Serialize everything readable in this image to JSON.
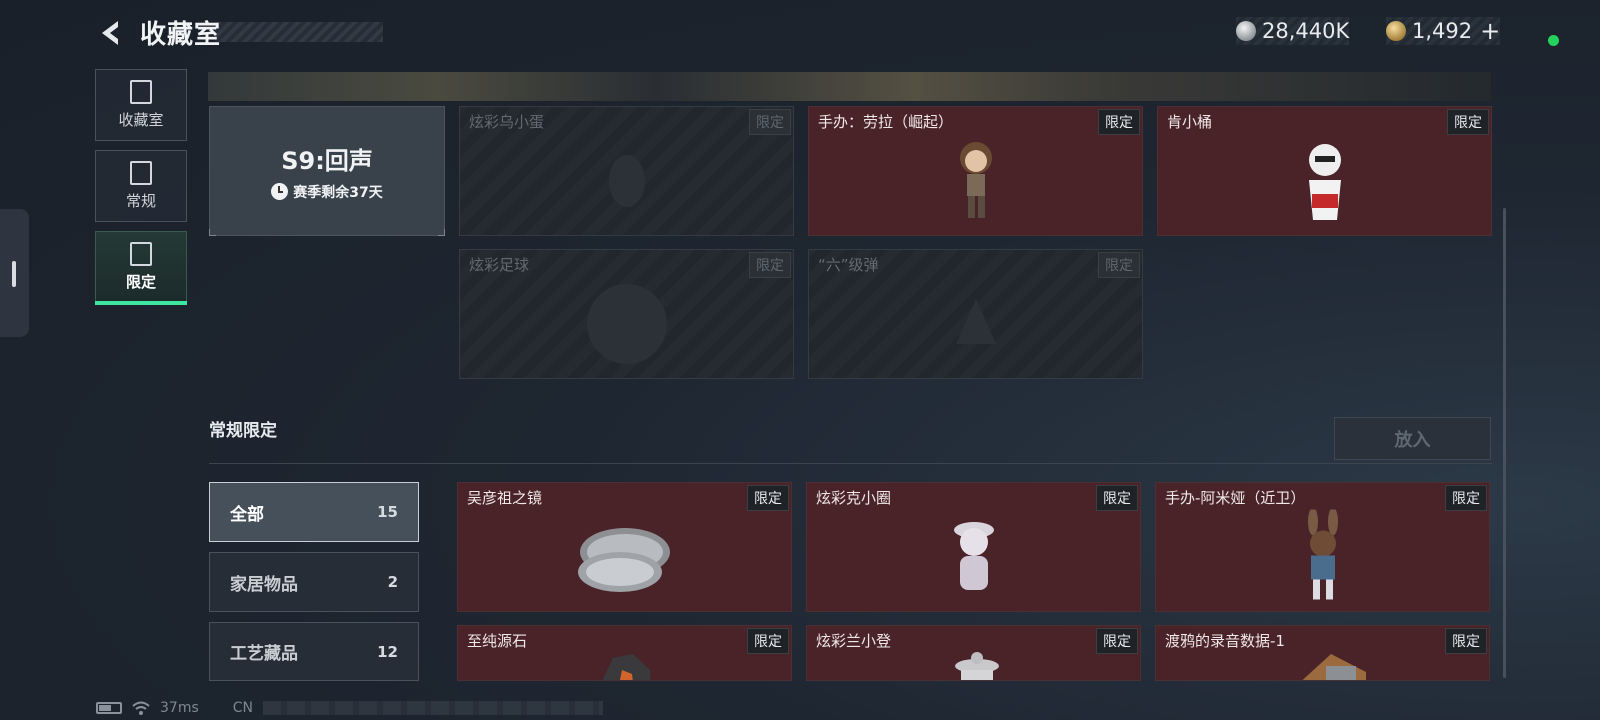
{
  "header": {
    "title": "收藏室",
    "currency_silver": "28,440K",
    "currency_gold": "1,492",
    "plus": "+"
  },
  "nav": [
    {
      "label": "收藏室",
      "icon": "vault-icon"
    },
    {
      "label": "常规",
      "icon": "pedestal-icon"
    },
    {
      "label": "限定",
      "icon": "limited-icon"
    }
  ],
  "season": {
    "name": "S9:回声",
    "remaining": "赛季剩余37天"
  },
  "season_cards": [
    {
      "name": "炫彩乌小蛋",
      "tag": "限定",
      "locked": true
    },
    {
      "name": "手办：劳拉（崛起）",
      "tag": "限定",
      "locked": false
    },
    {
      "name": "肯小桶",
      "tag": "限定",
      "locked": false
    },
    {
      "name": "炫彩足球",
      "tag": "限定",
      "locked": true
    },
    {
      "name": "“六”级弹",
      "tag": "限定",
      "locked": true
    }
  ],
  "section": {
    "title": "常规限定",
    "put_button": "放入"
  },
  "filters": [
    {
      "label": "全部",
      "count": "15"
    },
    {
      "label": "家居物品",
      "count": "2"
    },
    {
      "label": "工艺藏品",
      "count": "12"
    }
  ],
  "items": [
    {
      "name": "吴彦祖之镜",
      "tag": "限定"
    },
    {
      "name": "炫彩克小圈",
      "tag": "限定"
    },
    {
      "name": "手办-阿米娅（近卫）",
      "tag": "限定"
    },
    {
      "name": "至纯源石",
      "tag": "限定"
    },
    {
      "name": "炫彩兰小登",
      "tag": "限定"
    },
    {
      "name": "渡鸦的录音数据-1",
      "tag": "限定"
    }
  ],
  "footer": {
    "ping": "37ms",
    "region": "CN"
  }
}
